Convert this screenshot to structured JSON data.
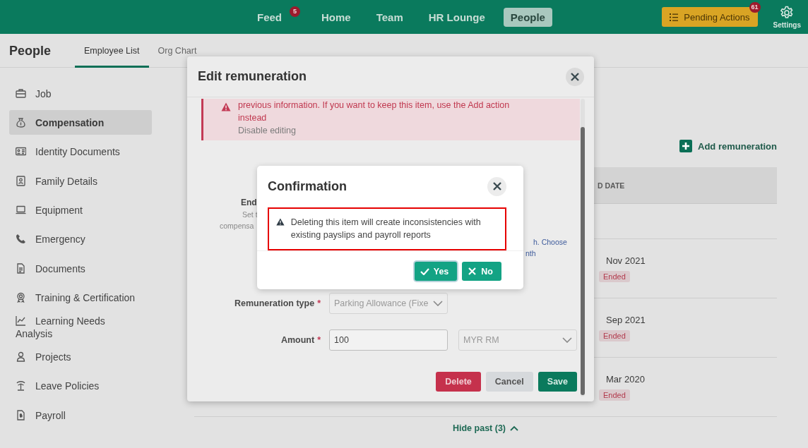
{
  "header": {
    "nav": [
      {
        "label": "Feed",
        "badge": "5",
        "selected": false
      },
      {
        "label": "Home",
        "selected": false
      },
      {
        "label": "Team",
        "selected": false
      },
      {
        "label": "HR Lounge",
        "selected": false
      },
      {
        "label": "People",
        "selected": true
      }
    ],
    "pending_actions": {
      "label": "Pending Actions",
      "badge": "61"
    },
    "settings": {
      "label": "Settings"
    }
  },
  "subheader": {
    "title": "People",
    "tabs": [
      {
        "label": "Employee List",
        "selected": true
      },
      {
        "label": "Org Chart",
        "selected": false
      }
    ]
  },
  "sidebar": {
    "items": [
      {
        "label": "Job",
        "selected": false
      },
      {
        "label": "Compensation",
        "selected": true
      },
      {
        "label": "Identity Documents",
        "selected": false
      },
      {
        "label": "Family Details",
        "selected": false
      },
      {
        "label": "Equipment",
        "selected": false
      },
      {
        "label": "Emergency",
        "selected": false
      },
      {
        "label": "Documents",
        "selected": false
      },
      {
        "label": "Training & Certification",
        "selected": false
      },
      {
        "label": "Learning Needs Analysis",
        "selected": false
      },
      {
        "label": "Projects",
        "selected": false
      },
      {
        "label": "Leave Policies",
        "selected": false
      },
      {
        "label": "Payroll",
        "selected": false
      }
    ]
  },
  "content": {
    "add_button": "Add remuneration",
    "table": {
      "column_header": "D DATE",
      "rows": [
        {
          "end_date": "",
          "status": ""
        },
        {
          "end_date": "Nov 2021",
          "status": "Ended"
        },
        {
          "end_date": "Sep 2021",
          "status": "Ended"
        },
        {
          "end_date": "Mar 2020",
          "status": "Ended"
        }
      ]
    },
    "toggle": "Hide past (3)"
  },
  "edit_modal": {
    "title": "Edit remuneration",
    "alert": {
      "lines": [
        "previous information. If you want to keep this item, use the Add action",
        "instead"
      ],
      "action": "Disable editing"
    },
    "fragments": [
      "End",
      "Set t",
      "compensa",
      "h. Choose",
      "nth"
    ],
    "fields": [
      {
        "label": "Remuneration type",
        "required_mark": "*",
        "value": "Parking Allowance (Fixe",
        "disabled": true
      },
      {
        "label": "Amount",
        "required_mark": "*",
        "value": "100",
        "currency": "MYR RM",
        "currency_disabled": true
      }
    ],
    "buttons": [
      {
        "label": "Delete",
        "kind": "danger"
      },
      {
        "label": "Cancel",
        "kind": "neutral"
      },
      {
        "label": "Save",
        "kind": "primary"
      }
    ]
  },
  "confirmation": {
    "title": "Confirmation",
    "message": "Deleting this item will create inconsistencies with existing payslips and payroll reports",
    "buttons": [
      {
        "label": "Yes",
        "kind": "yes",
        "focused": true
      },
      {
        "label": "No",
        "kind": "no",
        "focused": false
      }
    ]
  }
}
